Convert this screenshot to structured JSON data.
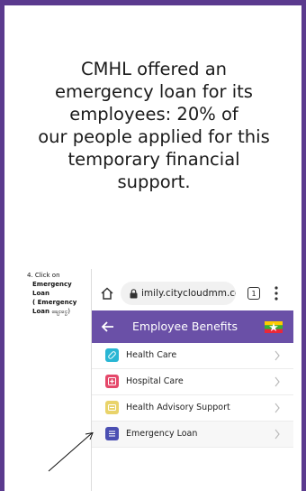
{
  "headline": {
    "lines": [
      "CMHL offered an",
      "emergency loan for its",
      "employees: 20% of",
      "our people applied for this",
      "temporary financial",
      "support."
    ]
  },
  "instruction": {
    "step": "4.  Click on",
    "bold1": "Emergency Loan",
    "bold2": "( Emergency",
    "bold3": "Loan",
    "burmese": "ချေးငွေ)"
  },
  "browser": {
    "url": "imily.citycloudmm.com",
    "tab_count": "1",
    "icons": [
      "home-icon",
      "lock-icon",
      "tabs-icon",
      "more-vert-icon"
    ]
  },
  "appbar": {
    "title": "Employee Benefits",
    "back_icon": "arrow-left-icon",
    "flag_icon": "myanmar-flag-icon"
  },
  "menu": {
    "items": [
      {
        "label": "Health Care",
        "icon": "bandage-icon",
        "color": "#29b6d4"
      },
      {
        "label": "Hospital Care",
        "icon": "hospital-icon",
        "color": "#e5486a"
      },
      {
        "label": "Health Advisory Support",
        "icon": "advice-icon",
        "color": "#e9d36a"
      },
      {
        "label": "Emergency Loan",
        "icon": "list-icon",
        "color": "#4b4fb2"
      }
    ]
  },
  "colors": {
    "frame": "#5b3a8e",
    "appbar": "#6a50a7"
  }
}
